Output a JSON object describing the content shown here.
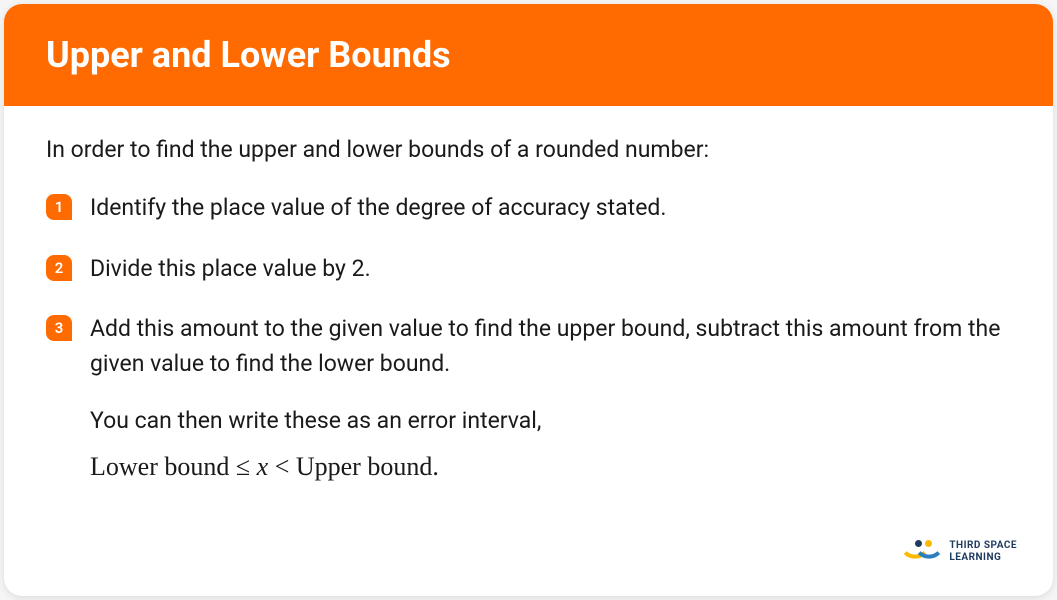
{
  "header": {
    "title": "Upper and Lower Bounds"
  },
  "intro": "In order to find the upper and lower bounds of a rounded number:",
  "steps": [
    {
      "number": "1",
      "text": "Identify the place value of the degree of accuracy stated."
    },
    {
      "number": "2",
      "text": "Divide this place value by 2."
    },
    {
      "number": "3",
      "text": "Add this amount to the given value to find the upper bound, subtract this amount from the given value to find the lower bound."
    }
  ],
  "footer": "You can then write these as an error interval,",
  "formula": {
    "lower": "Lower bound",
    "leq": "≤",
    "var": "x",
    "lt": "<",
    "upper": "Upper bound."
  },
  "logo": {
    "line1": "THIRD SPACE",
    "line2": "LEARNING"
  }
}
